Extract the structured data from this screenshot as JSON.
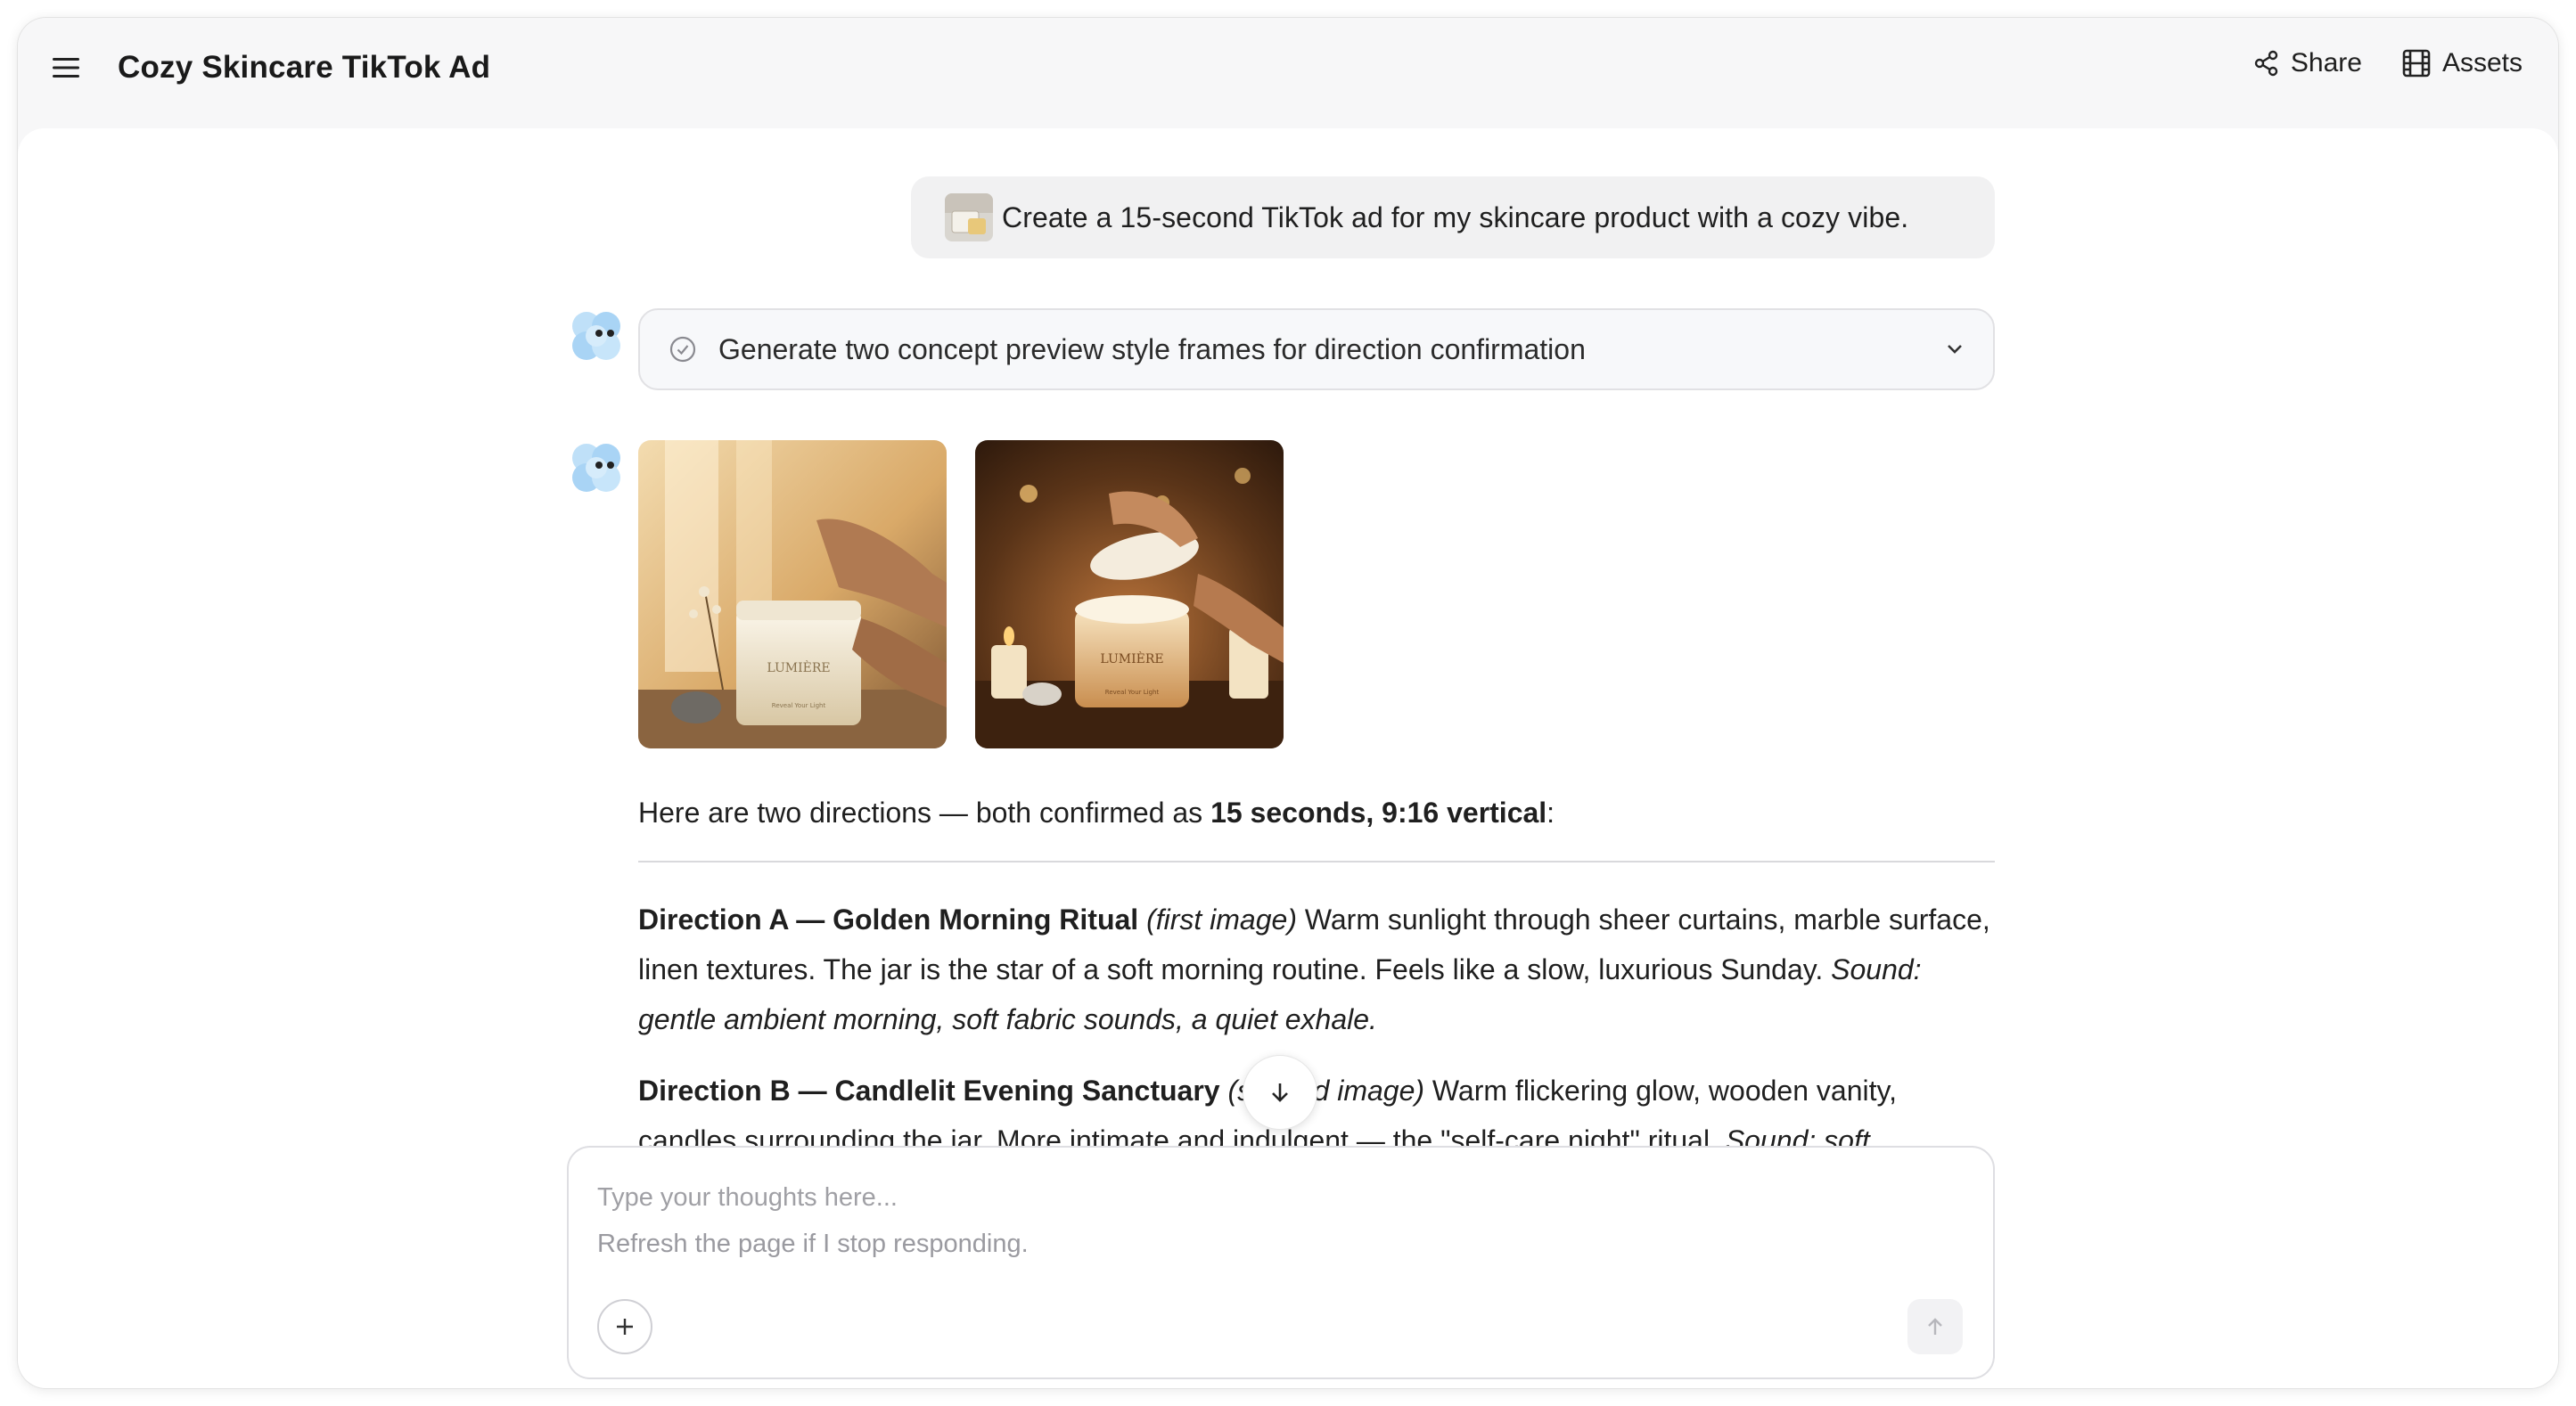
{
  "header": {
    "title": "Cozy Skincare TikTok Ad",
    "share_label": "Share",
    "assets_label": "Assets"
  },
  "user_message": {
    "text": "Create a 15-second TikTok ad for my skincare product with a cozy vibe."
  },
  "task": {
    "label": "Generate two concept preview style frames for direction confirmation",
    "status_icon": "check-circle-icon",
    "expand_icon": "chevron-down-icon"
  },
  "assistant": {
    "images": [
      {
        "product_label": "LUMIÈRE",
        "tag": "Reveal Your Light"
      },
      {
        "product_label": "LUMIÈRE",
        "tag": "Reveal Your Light"
      }
    ],
    "intro": {
      "prefix": "Here are two directions — both confirmed as ",
      "bold": "15 seconds, 9:16 vertical",
      "suffix": ":"
    },
    "direction_a": {
      "title": "Direction A — Golden Morning Ritual",
      "ref": "(first image)",
      "body": " Warm sunlight through sheer curtains, marble surface, linen textures. The jar is the star of a soft morning routine. Feels like a slow, luxurious Sunday. ",
      "sound": "Sound: gentle ambient morning, soft fabric sounds, a quiet exhale."
    },
    "direction_b": {
      "title": "Direction B — Candlelit Evening Sanctuary",
      "ref": "(second image)",
      "body": " Warm flickering glow, wooden vanity, candles surrounding the jar. More intimate and indulgent — the \"self-care night\" ritual. ",
      "sound": "Sound: soft"
    }
  },
  "composer": {
    "placeholder": "Type your thoughts here...",
    "hint": "Refresh the page if I stop responding."
  },
  "colors": {
    "accent_avatar": "#a9d4f5",
    "text": "#1f1f1f",
    "muted": "#9a9aa0"
  }
}
